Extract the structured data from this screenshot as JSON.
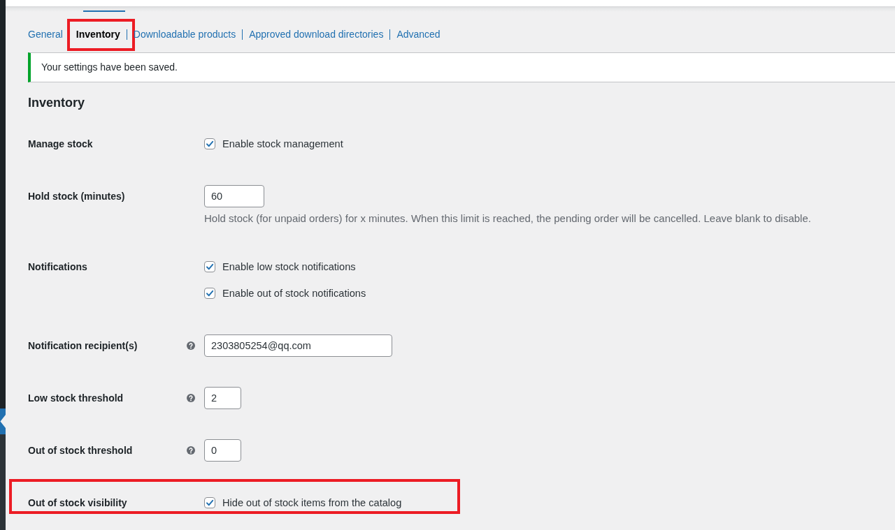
{
  "tabs": [
    {
      "label": "General",
      "selected": false,
      "highlighted": false
    },
    {
      "label": "Inventory",
      "selected": true,
      "highlighted": true
    },
    {
      "label": "Downloadable products",
      "selected": false,
      "highlighted": false
    },
    {
      "label": "Approved download directories",
      "selected": false,
      "highlighted": false
    },
    {
      "label": "Advanced",
      "selected": false,
      "highlighted": false
    }
  ],
  "notice": {
    "kind": "success",
    "text": "Your settings have been saved."
  },
  "section": {
    "title": "Inventory"
  },
  "fields": [
    {
      "kind": "checkboxes",
      "label": "Manage stock",
      "help": false,
      "highlighted": false,
      "options": [
        {
          "label": "Enable stock management",
          "checked": true
        }
      ]
    },
    {
      "kind": "input",
      "label": "Hold stock (minutes)",
      "help": false,
      "highlighted": false,
      "value": "60",
      "description": "Hold stock (for unpaid orders) for x minutes. When this limit is reached, the pending order will be cancelled. Leave blank to disable."
    },
    {
      "kind": "checkboxes",
      "label": "Notifications",
      "help": false,
      "highlighted": false,
      "options": [
        {
          "label": "Enable low stock notifications",
          "checked": true
        },
        {
          "label": "Enable out of stock notifications",
          "checked": true
        }
      ]
    },
    {
      "kind": "input",
      "label": "Notification recipient(s)",
      "help": true,
      "highlighted": false,
      "value": "2303805254@qq.com"
    },
    {
      "kind": "input",
      "label": "Low stock threshold",
      "help": true,
      "highlighted": false,
      "value": "2"
    },
    {
      "kind": "input",
      "label": "Out of stock threshold",
      "help": true,
      "highlighted": false,
      "value": "0"
    },
    {
      "kind": "checkboxes",
      "label": "Out of stock visibility",
      "help": false,
      "highlighted": true,
      "options": [
        {
          "label": "Hide out of stock items from the catalog",
          "checked": true
        }
      ]
    }
  ]
}
